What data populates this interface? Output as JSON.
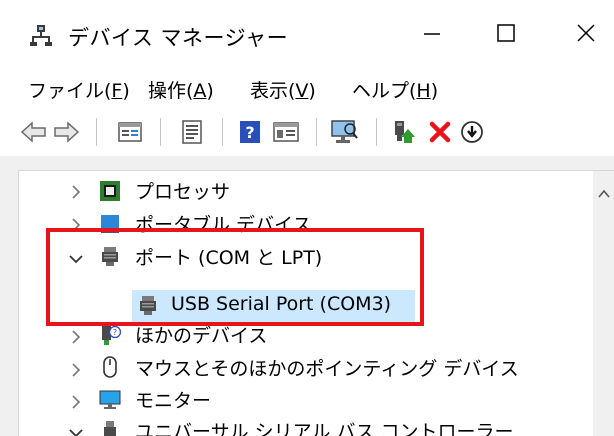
{
  "window": {
    "title": "デバイス マネージャー",
    "icon": "device-manager-icon",
    "controls": {
      "minimize": "minimize-icon",
      "maximize": "maximize-icon",
      "close": "close-icon"
    }
  },
  "menubar": {
    "items": [
      {
        "label": "ファイル(",
        "accel": "F",
        "end": ")"
      },
      {
        "label": "操作(",
        "accel": "A",
        "end": ")"
      },
      {
        "label": "表示(",
        "accel": "V",
        "end": ")"
      },
      {
        "label": "ヘルプ(",
        "accel": "H",
        "end": ")"
      }
    ]
  },
  "toolbar": {
    "buttons": [
      "back-arrow-icon",
      "forward-arrow-icon",
      "properties-icon",
      "show-hide-icon",
      "help-icon",
      "resource-view-icon",
      "scan-hardware-icon",
      "update-driver-icon",
      "uninstall-icon",
      "disable-device-icon"
    ],
    "uninstall_color": "#e8141c",
    "update_color": "#2e9c2e"
  },
  "tree": {
    "items": [
      {
        "label": "プロセッサ",
        "state": "collapsed",
        "icon": "processor-icon"
      },
      {
        "label": "ポータブル デバイス",
        "state": "collapsed",
        "icon": "portable-device-icon"
      },
      {
        "label": "ポート (COM と LPT)",
        "state": "expanded",
        "icon": "port-icon"
      },
      {
        "label": "USB Serial Port (COM3)",
        "state": "child-selected",
        "icon": "port-icon"
      },
      {
        "label": "ほかのデバイス",
        "state": "collapsed",
        "icon": "unknown-device-icon"
      },
      {
        "label": "マウスとそのほかのポインティング デバイス",
        "state": "collapsed",
        "icon": "mouse-icon"
      },
      {
        "label": "モニター",
        "state": "collapsed",
        "icon": "monitor-icon"
      },
      {
        "label": "ユニバーサル シリアル バス コントローラー",
        "state": "expanded",
        "icon": "usb-icon"
      }
    ],
    "selection_color": "#cce8ff",
    "highlight_color": "#e8141c"
  }
}
